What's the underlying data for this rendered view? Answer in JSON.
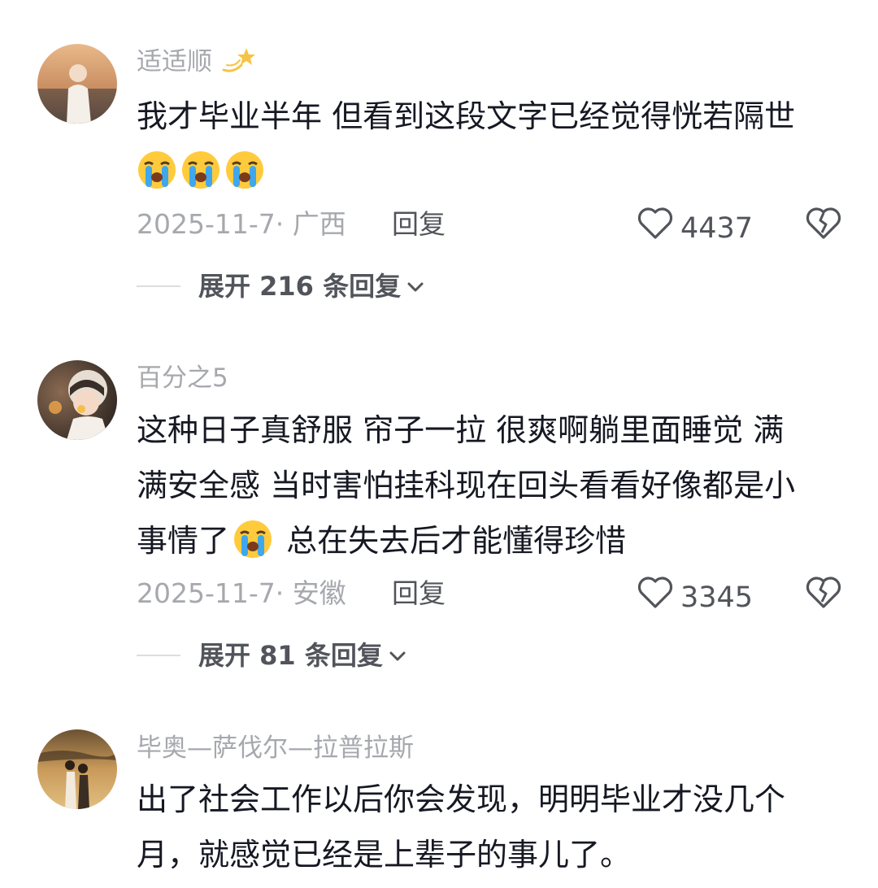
{
  "comments": [
    {
      "username": "适适顺",
      "username_badge_icon": "dizzy-star-icon",
      "text_lines": [
        "我才毕业半年 但看到这段文字已经觉得恍若隔世"
      ],
      "text_trailing_emojis": [
        "loudly-crying-face-icon",
        "loudly-crying-face-icon",
        "loudly-crying-face-icon"
      ],
      "date_location": "2025-11-7· 广西",
      "reply_label": "回复",
      "likes": "4437",
      "expand_label": "展开 216 条回复"
    },
    {
      "username": "百分之5",
      "text_lines": [
        "这种日子真舒服 帘子一拉 很爽啊躺里面睡觉 满",
        "满安全感 当时害怕挂科现在回头看看好像都是小"
      ],
      "text_line3_before": "事情了",
      "text_line3_emoji": "loudly-crying-face-icon",
      "text_line3_after": " 总在失去后才能懂得珍惜",
      "date_location": "2025-11-7· 安徽",
      "reply_label": "回复",
      "likes": "3345",
      "expand_label": "展开 81 条回复"
    },
    {
      "username": "毕奥—萨伐尔—拉普拉斯",
      "text_lines": [
        "出了社会工作以后你会发现，明明毕业才没几个",
        "月，就感觉已经是上辈子的事儿了。"
      ]
    }
  ],
  "colors": {
    "text": "#161823",
    "secondary": "#a6a8ad",
    "action": "#52545b"
  }
}
